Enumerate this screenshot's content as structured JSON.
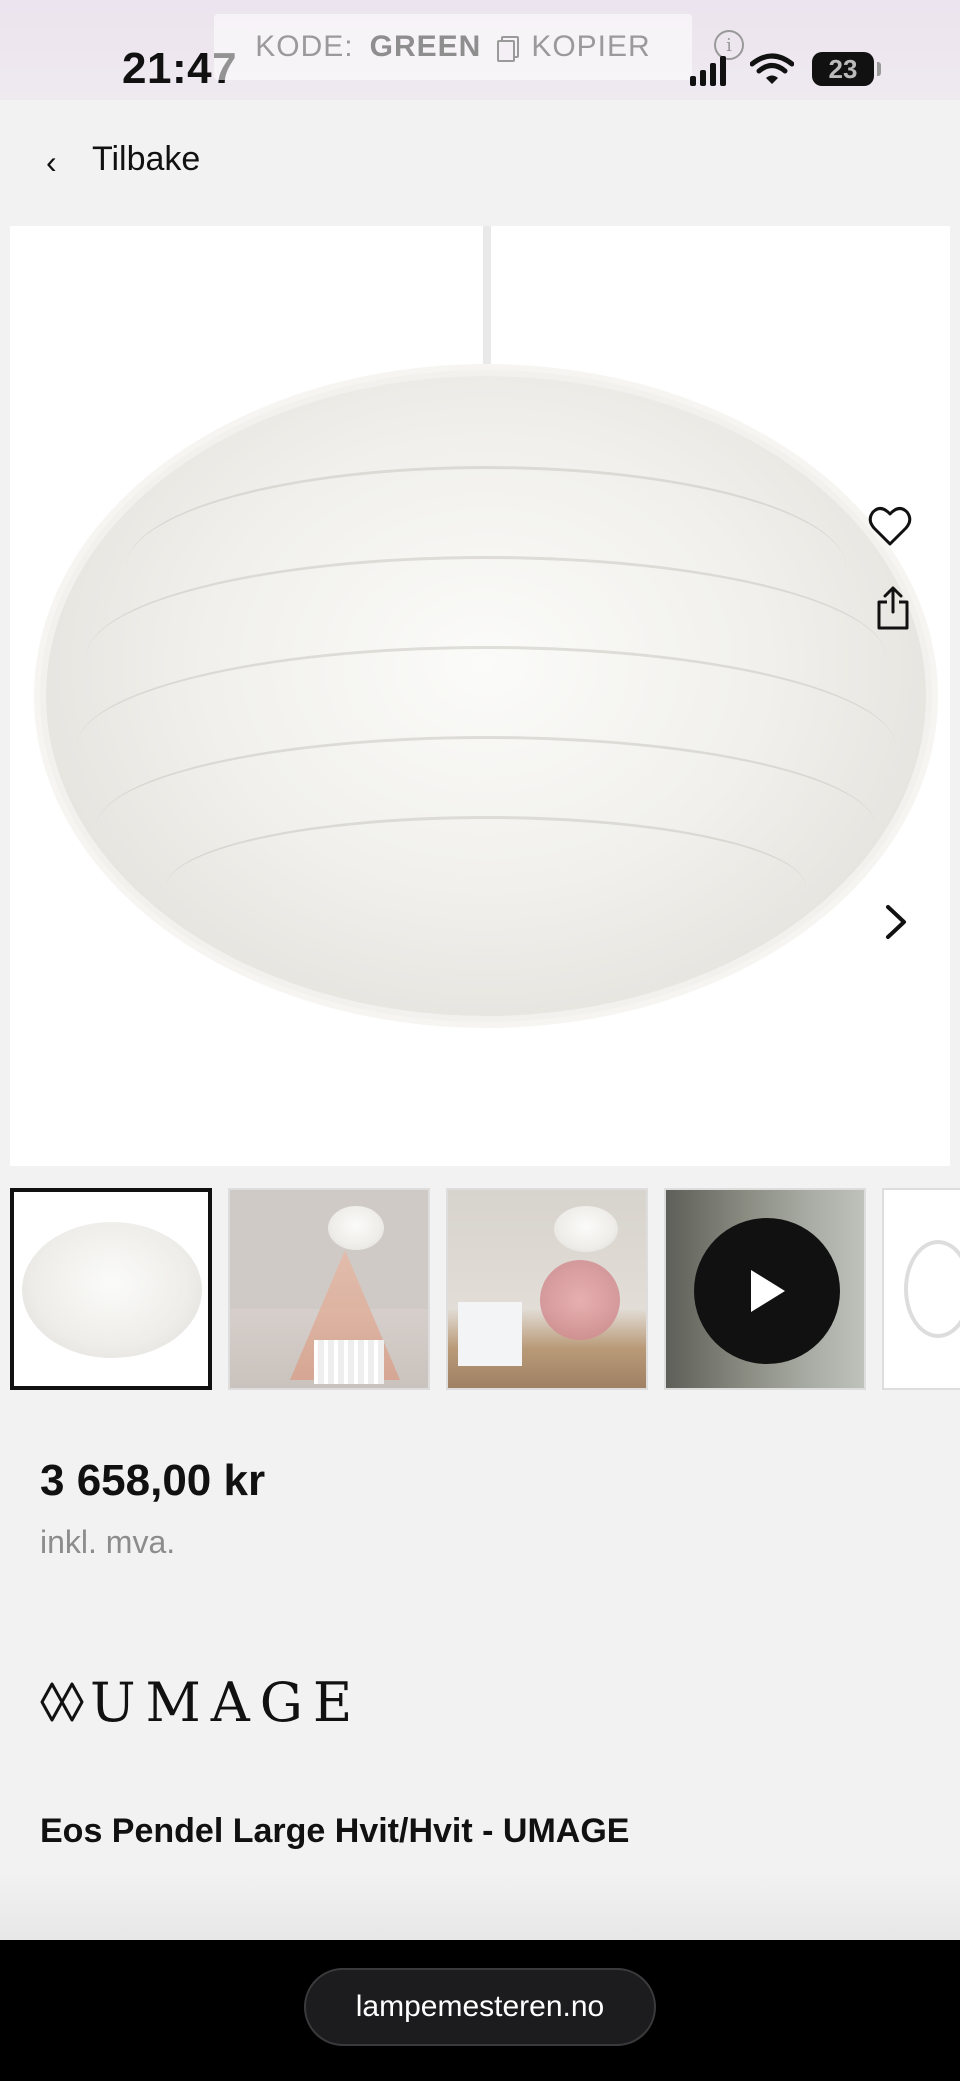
{
  "status_bar": {
    "time": "21:47",
    "promo": {
      "label": "KODE:",
      "code": "GREEN",
      "copy_label": "KOPIER"
    },
    "battery_level": "23"
  },
  "nav": {
    "back_label": "Tilbake"
  },
  "gallery": {
    "images": [
      "feather-pendant-white",
      "nursery-photo-1",
      "nursery-photo-2",
      "video-thumbnail",
      "pendant-detail"
    ],
    "active_index": 0
  },
  "product": {
    "price": "3 658,00 kr",
    "vat_note": "inkl. mva.",
    "brand": "UMAGE",
    "title": "Eos Pendel Large Hvit/Hvit - UMAGE"
  },
  "browser": {
    "url": "lampemesteren.no"
  },
  "colors": {
    "background": "#f2f2f2",
    "text": "#111111",
    "muted": "#8c8c8c",
    "url_bar": "#000000"
  }
}
